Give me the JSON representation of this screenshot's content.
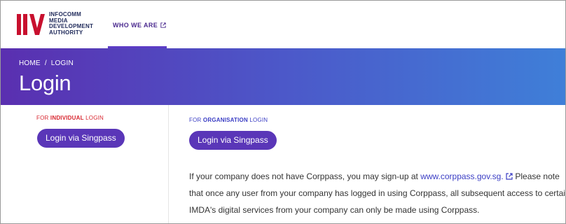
{
  "header": {
    "logo_lines": [
      "INFOCOMM",
      "MEDIA",
      "DEVELOPMENT",
      "AUTHORITY"
    ],
    "nav_link": "WHO WE ARE",
    "colors": {
      "logo_red": "#c8102e",
      "nav_text": "#4b2a8f"
    }
  },
  "banner": {
    "breadcrumb": {
      "home": "HOME",
      "separator": "/",
      "current": "LOGIN"
    },
    "title": "Login",
    "colors": {
      "gradient_start": "#5a2fb0",
      "gradient_end": "#3f7fd8"
    }
  },
  "individual": {
    "label_pre": "FOR ",
    "label_bold": "INDIVIDUAL",
    "label_post": " LOGIN",
    "button": "Login via Singpass"
  },
  "organisation": {
    "label_pre": "FOR ",
    "label_bold": "ORGANISATION",
    "label_post": " LOGIN",
    "button": "Login via Singpass",
    "para_line1_pre": "If your company does not have Corppass, you may sign-up at ",
    "para_link": "www.corppass.gov.sg.",
    "para_line1_post": " Please note",
    "para_line2": "that once any user from your company has logged in using Corppass, all subsequent access to certain",
    "para_line3": "IMDA's digital services from your company can only be made using Corppass."
  }
}
